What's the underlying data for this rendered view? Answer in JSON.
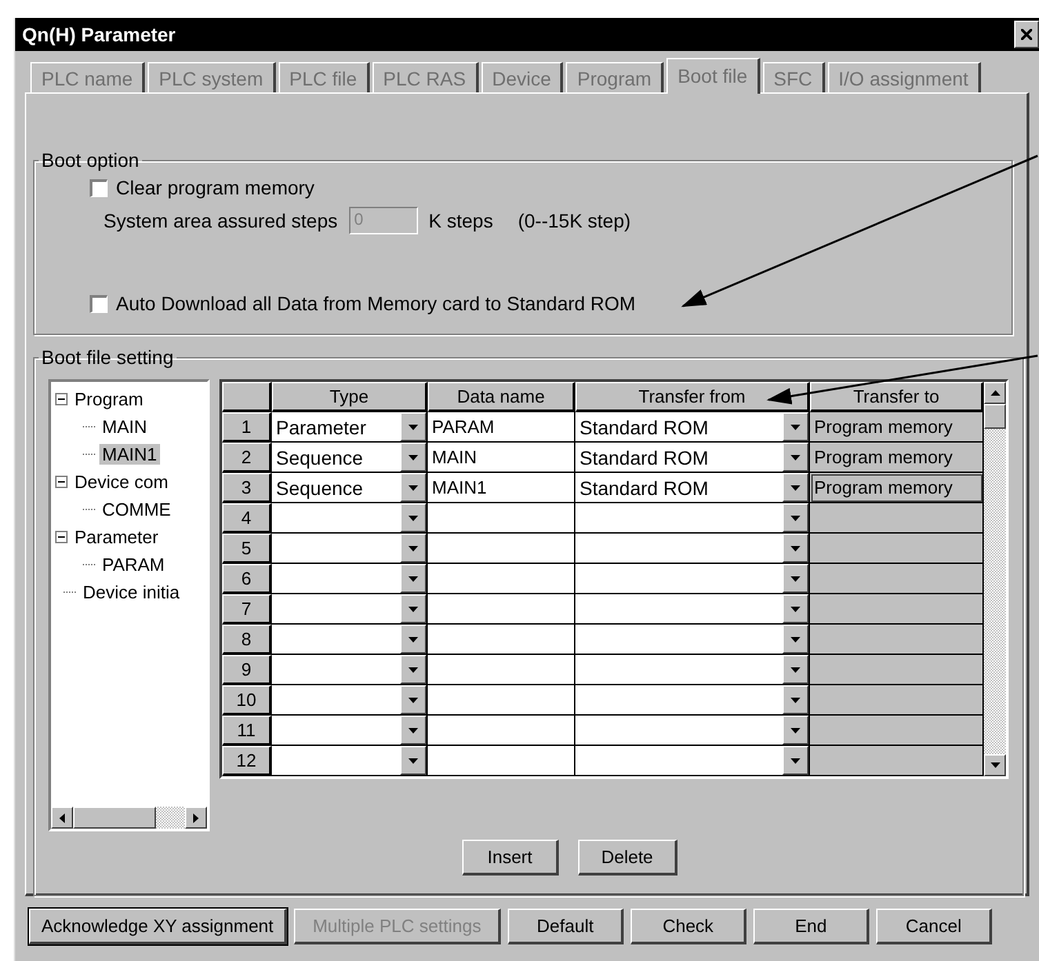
{
  "window": {
    "title": "Qn(H) Parameter"
  },
  "tabs": [
    {
      "label": "PLC name",
      "selected": false
    },
    {
      "label": "PLC system",
      "selected": false
    },
    {
      "label": "PLC file",
      "selected": false
    },
    {
      "label": "PLC RAS",
      "selected": false
    },
    {
      "label": "Device",
      "selected": false
    },
    {
      "label": "Program",
      "selected": false
    },
    {
      "label": "Boot file",
      "selected": true
    },
    {
      "label": "SFC",
      "selected": false
    },
    {
      "label": "I/O assignment",
      "selected": false
    }
  ],
  "boot_option": {
    "title": "Boot option",
    "clear_memory": {
      "label": "Clear program memory",
      "checked": false
    },
    "steps": {
      "label": "System area assured steps",
      "value": "0",
      "disabled": true,
      "unit": "K steps",
      "range": "(0--15K step)"
    },
    "auto_download": {
      "label": "Auto Download all Data from Memory card to Standard ROM",
      "checked": false
    }
  },
  "boot_file_setting": {
    "title": "Boot file setting",
    "tree": [
      {
        "label": "Program",
        "expanded": true,
        "selected": false,
        "children": [
          {
            "label": "MAIN",
            "selected": false
          },
          {
            "label": "MAIN1",
            "selected": true
          }
        ]
      },
      {
        "label": "Device com",
        "expanded": true,
        "selected": false,
        "children": [
          {
            "label": "COMME",
            "selected": false
          }
        ]
      },
      {
        "label": "Parameter",
        "expanded": true,
        "selected": false,
        "children": [
          {
            "label": "PARAM",
            "selected": false
          }
        ]
      },
      {
        "label": "Device initia",
        "selected": false
      }
    ],
    "table": {
      "columns": [
        "Type",
        "Data name",
        "Transfer from",
        "Transfer to"
      ],
      "rows": [
        {
          "number": "1",
          "type": "Parameter",
          "data_name": "PARAM",
          "transfer_from": "Standard ROM",
          "transfer_to": "Program memory",
          "focused": false
        },
        {
          "number": "2",
          "type": "Sequence",
          "data_name": "MAIN",
          "transfer_from": "Standard ROM",
          "transfer_to": "Program memory",
          "focused": false
        },
        {
          "number": "3",
          "type": "Sequence",
          "data_name": "MAIN1",
          "transfer_from": "Standard ROM",
          "transfer_to": "Program memory",
          "focused": true
        },
        {
          "number": "4",
          "focused": false
        },
        {
          "number": "5",
          "focused": false
        },
        {
          "number": "6",
          "focused": false
        },
        {
          "number": "7",
          "focused": false
        },
        {
          "number": "8",
          "focused": false
        },
        {
          "number": "9",
          "focused": false
        },
        {
          "number": "10",
          "focused": false
        },
        {
          "number": "11",
          "focused": false
        },
        {
          "number": "12",
          "focused": false
        }
      ]
    },
    "buttons": [
      "Insert",
      "Delete"
    ]
  },
  "buttons": [
    {
      "label": "Acknowledge XY assignment",
      "default": true,
      "disabled": false
    },
    {
      "label": "Multiple PLC settings",
      "default": false,
      "disabled": true
    },
    {
      "label": "Default",
      "default": false,
      "disabled": false
    },
    {
      "label": "Check",
      "default": false,
      "disabled": false
    },
    {
      "label": "End",
      "default": false,
      "disabled": false
    },
    {
      "label": "Cancel",
      "default": false,
      "disabled": false
    }
  ]
}
